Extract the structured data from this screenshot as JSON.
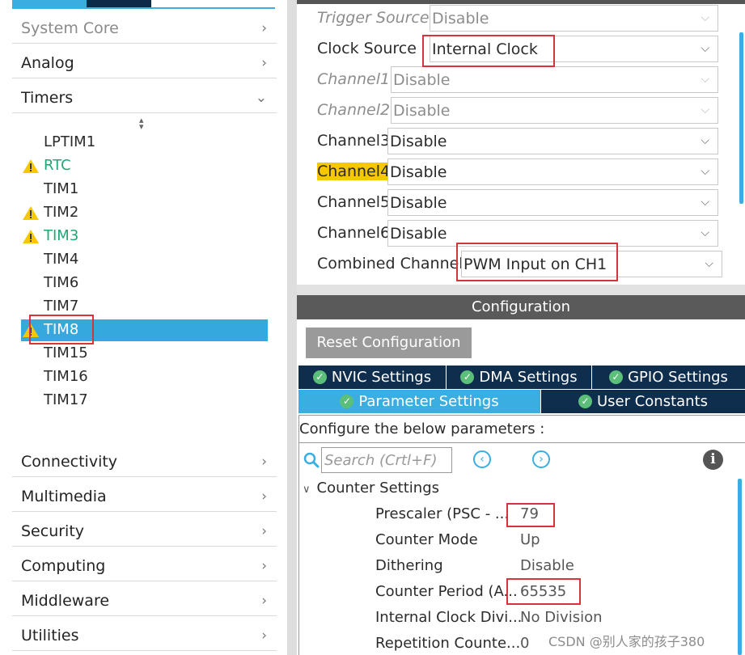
{
  "colors": {
    "accent": "#3aaee0",
    "navy": "#0f2d4d",
    "warning": "#f5c800",
    "highlight_box": "#d6343b",
    "success": "#5bbf7a"
  },
  "left": {
    "categories_top": [
      {
        "label": "System Core",
        "icon": "chevron-right-icon"
      },
      {
        "label": "Analog",
        "icon": "chevron-right-icon"
      },
      {
        "label": "Timers",
        "icon": "chevron-down-icon"
      }
    ],
    "timers": [
      {
        "label": "LPTIM1",
        "warning": false
      },
      {
        "label": "RTC",
        "warning": true
      },
      {
        "label": "TIM1",
        "warning": false
      },
      {
        "label": "TIM2",
        "warning": true
      },
      {
        "label": "TIM3",
        "warning": true
      },
      {
        "label": "TIM4",
        "warning": false
      },
      {
        "label": "TIM6",
        "warning": false
      },
      {
        "label": "TIM7",
        "warning": false
      },
      {
        "label": "TIM8",
        "warning": true,
        "selected": true
      },
      {
        "label": "TIM15",
        "warning": false
      },
      {
        "label": "TIM16",
        "warning": false
      },
      {
        "label": "TIM17",
        "warning": false
      }
    ],
    "categories_bottom": [
      {
        "label": "Connectivity",
        "icon": "chevron-right-icon"
      },
      {
        "label": "Multimedia",
        "icon": "chevron-right-icon"
      },
      {
        "label": "Security",
        "icon": "chevron-right-icon"
      },
      {
        "label": "Computing",
        "icon": "chevron-right-icon"
      },
      {
        "label": "Middleware",
        "icon": "chevron-right-icon"
      },
      {
        "label": "Utilities",
        "icon": "chevron-right-icon"
      }
    ]
  },
  "mode": {
    "rows": [
      {
        "label": "Trigger Source",
        "value": "Disable",
        "disabled": true
      },
      {
        "label": "Clock Source",
        "value": "Internal Clock",
        "disabled": false
      },
      {
        "label": "Channel1",
        "value": "Disable",
        "disabled": true
      },
      {
        "label": "Channel2",
        "value": "Disable",
        "disabled": true
      },
      {
        "label": "Channel3",
        "value": "Disable",
        "disabled": false
      },
      {
        "label": "Channel4",
        "value": "Disable",
        "disabled": false,
        "highlight": true
      },
      {
        "label": "Channel5",
        "value": "Disable",
        "disabled": false
      },
      {
        "label": "Channel6",
        "value": "Disable",
        "disabled": false
      },
      {
        "label": "Combined Channels",
        "value": "PWM Input on CH1",
        "disabled": false
      }
    ]
  },
  "config": {
    "header": "Configuration",
    "reset_label": "Reset Configuration",
    "tabs_row1": [
      {
        "label": "NVIC Settings"
      },
      {
        "label": "DMA Settings"
      },
      {
        "label": "GPIO Settings"
      }
    ],
    "tabs_row2": [
      {
        "label": "Parameter Settings",
        "active": true
      },
      {
        "label": "User Constants",
        "active": false
      }
    ],
    "description": "Configure the below parameters :",
    "search_placeholder": "Search (Crtl+F)",
    "nav_prev_icon": "arrow-left-circle-icon",
    "nav_next_icon": "arrow-right-circle-icon",
    "info_glyph": "i",
    "section": "Counter Settings",
    "params": [
      {
        "name": "Prescaler (PSC - ...",
        "value": "79"
      },
      {
        "name": "Counter Mode",
        "value": "Up"
      },
      {
        "name": "Dithering",
        "value": "Disable"
      },
      {
        "name": "Counter Period (A...",
        "value": "65535"
      },
      {
        "name": "Internal Clock Divi...",
        "value": "No Division"
      },
      {
        "name": "Repetition Counte...",
        "value": "0"
      }
    ]
  },
  "watermark": "CSDN @别人家的孩子380"
}
